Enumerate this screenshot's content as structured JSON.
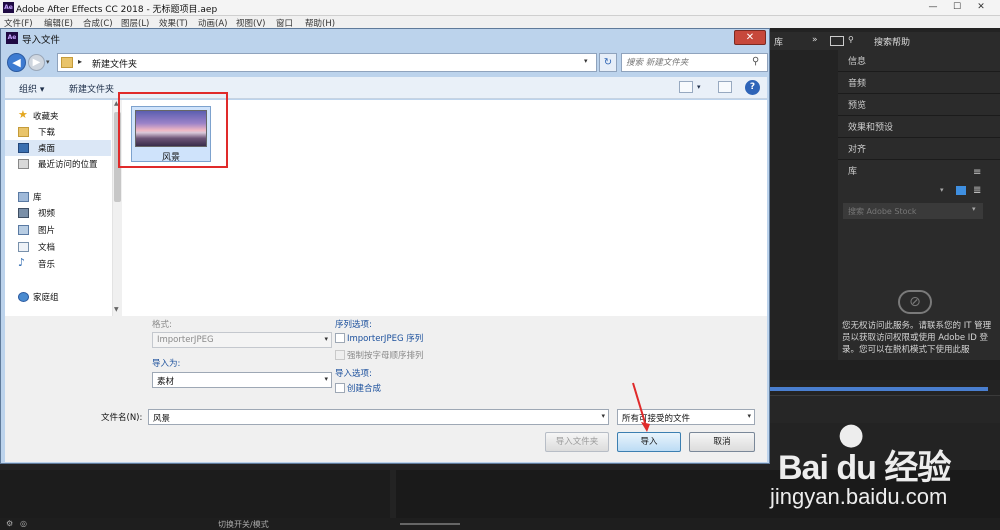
{
  "app": {
    "title": "Adobe After Effects CC 2018 - 无标题项目.aep",
    "logo": "Ae",
    "menu": [
      "文件(F)",
      "编辑(E)",
      "合成(C)",
      "图层(L)",
      "效果(T)",
      "动画(A)",
      "视图(V)",
      "窗口",
      "帮助(H)"
    ],
    "window_buttons": [
      "—",
      "☐",
      "✕"
    ],
    "toolbar_right": {
      "lib_label": "库",
      "search_help": "搜索帮助"
    },
    "panels": [
      "信息",
      "音频",
      "预览",
      "效果和预设",
      "对齐",
      "库"
    ],
    "stock_search_placeholder": "搜索 Adobe Stock",
    "library_message": "您无权访问此服务。请联系您的 IT 管理员以获取访问权限或使用 Adobe ID 登录。您可以在脱机模式下使用此服",
    "bottom_label": "切换开关/模式"
  },
  "dialog": {
    "title": "导入文件",
    "logo": "Ae",
    "close": "✕",
    "path": "新建文件夹",
    "search_placeholder": "搜索 新建文件夹",
    "toolbar": {
      "organize": "组织 ▾",
      "new_folder": "新建文件夹"
    },
    "nav": {
      "favorites": "收藏夹",
      "downloads": "下载",
      "desktop": "桌面",
      "recent": "最近访问的位置",
      "libraries": "库",
      "videos": "视频",
      "pictures": "图片",
      "documents": "文档",
      "music": "音乐",
      "homegroup": "家庭组"
    },
    "file": {
      "name": "风景"
    },
    "options": {
      "format_label": "格式:",
      "format_value": "ImporterJPEG",
      "import_as_label": "导入为:",
      "import_as_value": "素材",
      "sequence_label": "序列选项:",
      "sequence_importer": "ImporterJPEG 序列",
      "force_alpha": "强制按字母顺序排列",
      "import_options_label": "导入选项:",
      "create_comp": "创建合成"
    },
    "filename_label": "文件名(N):",
    "filename_value": "风景",
    "filetype_value": "所有可接受的文件",
    "buttons": {
      "import_folder": "导入文件夹",
      "import": "导入",
      "cancel": "取消"
    }
  },
  "watermark": {
    "brand": "Bai du 经验",
    "url": "jingyan.baidu.com"
  }
}
